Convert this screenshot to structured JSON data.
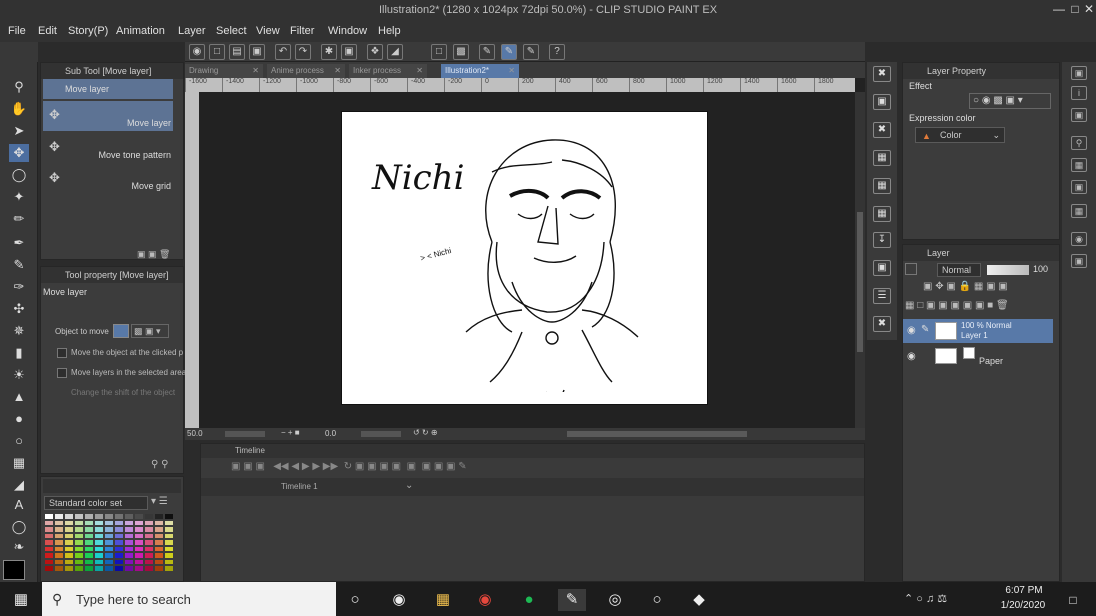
{
  "window": {
    "title": "Illustration2* (1280 x 1024px 72dpi 50.0%) - CLIP STUDIO PAINT EX"
  },
  "menu": [
    "File",
    "Edit",
    "Story(P)",
    "Animation",
    "Layer",
    "Select",
    "View",
    "Filter",
    "Window",
    "Help"
  ],
  "subtool": {
    "header": "Sub Tool [Move layer]",
    "group": "Move layer",
    "items": [
      "Move layer",
      "Move tone pattern",
      "Move grid"
    ]
  },
  "tool_property": {
    "header": "Tool property [Move layer]",
    "name": "Move layer",
    "object_label": "Object to move",
    "options": [
      "Move the object at the clicked p",
      "Move layers in the selected area",
      "Change the shift of the object"
    ]
  },
  "color_set": {
    "name": "Standard color set"
  },
  "canvas": {
    "tabs": [
      "Drawing",
      "Anime process",
      "Inker process",
      "Illustration2*"
    ],
    "ruler_labels": [
      "-1600",
      "-1400",
      "-1200",
      "-1000",
      "-800",
      "-600",
      "-400",
      "-200",
      "0",
      "200",
      "400",
      "600",
      "800",
      "1000",
      "1200",
      "1400",
      "1600",
      "1800"
    ],
    "zoom": "50.0",
    "rotate": "0.0",
    "art_text": "Nichi",
    "note_text": "> < Nichi"
  },
  "timeline": {
    "header": "Timeline",
    "dropdown": "Timeline 1"
  },
  "layer_property": {
    "header": "Layer Property",
    "effect_label": "Effect",
    "expression_label": "Expression color",
    "expression_value": "Color"
  },
  "layer_panel": {
    "header": "Layer",
    "blend_mode": "Normal",
    "opacity": "100",
    "layers": [
      {
        "mode": "100 % Normal",
        "name": "Layer 1"
      },
      {
        "name": "Paper"
      }
    ]
  },
  "taskbar": {
    "search_placeholder": "Type here to search",
    "time": "6:07 PM",
    "date": "1/20/2020"
  },
  "colors": {
    "accent": "#5879a8",
    "panel": "#3c3c3c",
    "canvas": "#ffffff"
  }
}
